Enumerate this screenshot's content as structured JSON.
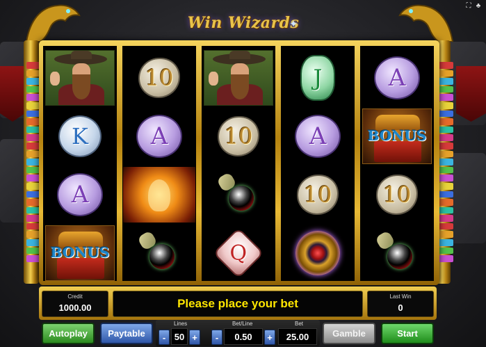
{
  "game": {
    "title": "Win Wizards"
  },
  "reels": [
    [
      "wizard",
      "K",
      "A",
      "BONUS"
    ],
    [
      "10",
      "A",
      "phoenix",
      "potion"
    ],
    [
      "wizard",
      "10",
      "potion",
      "Q"
    ],
    [
      "J",
      "A",
      "10",
      "amulet"
    ],
    [
      "A",
      "BONUS",
      "10",
      "potion"
    ]
  ],
  "panel": {
    "credit_label": "Credit",
    "credit_value": "1000.00",
    "message": "Please place your bet",
    "last_win_label": "Last Win",
    "last_win_value": "0"
  },
  "controls": {
    "autoplay": "Autoplay",
    "paytable": "Paytable",
    "lines_label": "Lines",
    "lines_value": "50",
    "bet_line_label": "Bet/Line",
    "bet_line_value": "0.50",
    "bet_label": "Bet",
    "bet_value": "25.00",
    "minus": "-",
    "plus": "+",
    "gamble": "Gamble",
    "start": "Start"
  },
  "icons": {
    "fullscreen": "fullscreen-icon",
    "settings": "settings-icon"
  },
  "colors": {
    "message": "#ffe600",
    "frame_gold": "#e8b935",
    "button_green": "#2b8a1e",
    "button_blue": "#2f56a8"
  }
}
